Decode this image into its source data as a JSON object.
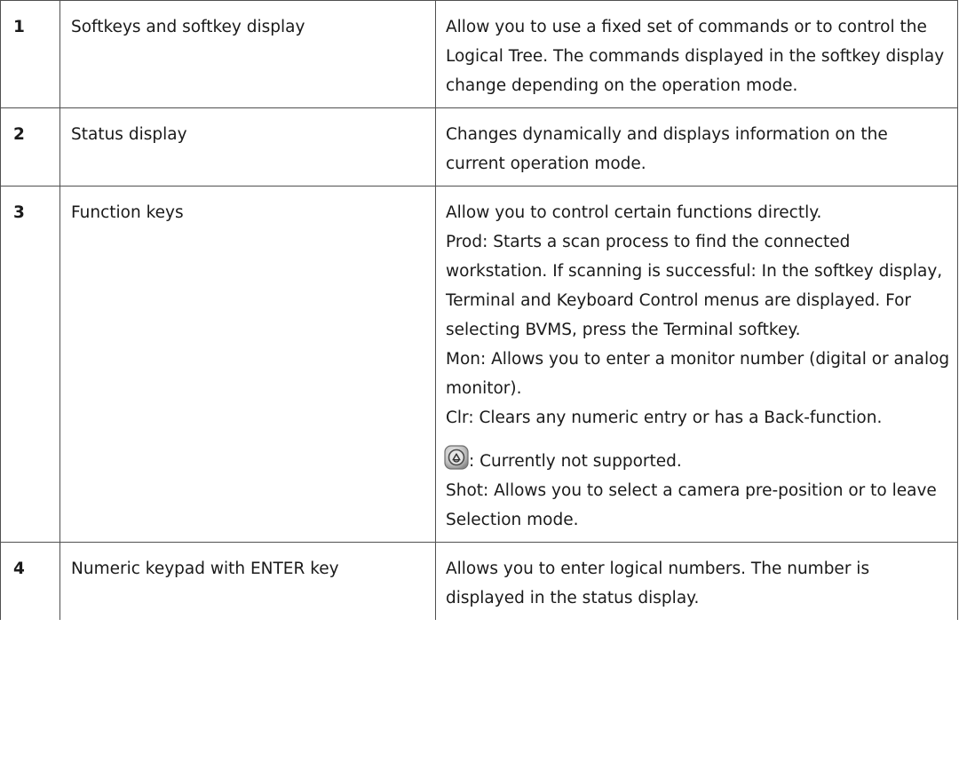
{
  "rows": [
    {
      "number": "1",
      "name": "Softkeys and softkey display",
      "description": "Allow you to use a fixed set of commands or to control the Logical Tree. The commands displayed in the softkey display change depending on the operation mode."
    },
    {
      "number": "2",
      "name": "Status display",
      "description": "Changes dynamically and displays information on the current operation mode."
    },
    {
      "number": "3",
      "name": "Function keys",
      "description_lines": {
        "intro": "Allow you to control certain functions directly.",
        "prod": "Prod: Starts a scan process to find the connected workstation. If scanning is successful: In the softkey display, Terminal and Keyboard Control menus are displayed. For selecting BVMS, press the Terminal softkey.",
        "mon": "Mon: Allows you to enter a monitor number (digital or analog monitor).",
        "clr": "Clr: Clears any numeric entry or has a Back-function.",
        "icon_key": ": Currently not supported.",
        "shot": "Shot: Allows you to select a camera pre-position or to leave Selection mode."
      },
      "icon": "keyboard-key-icon"
    },
    {
      "number": "4",
      "name": "Numeric keypad with ENTER key",
      "description": "Allows you to enter logical numbers. The number is displayed in the status display."
    }
  ],
  "colors": {
    "border": "#505050",
    "text": "#1a1a1a"
  }
}
